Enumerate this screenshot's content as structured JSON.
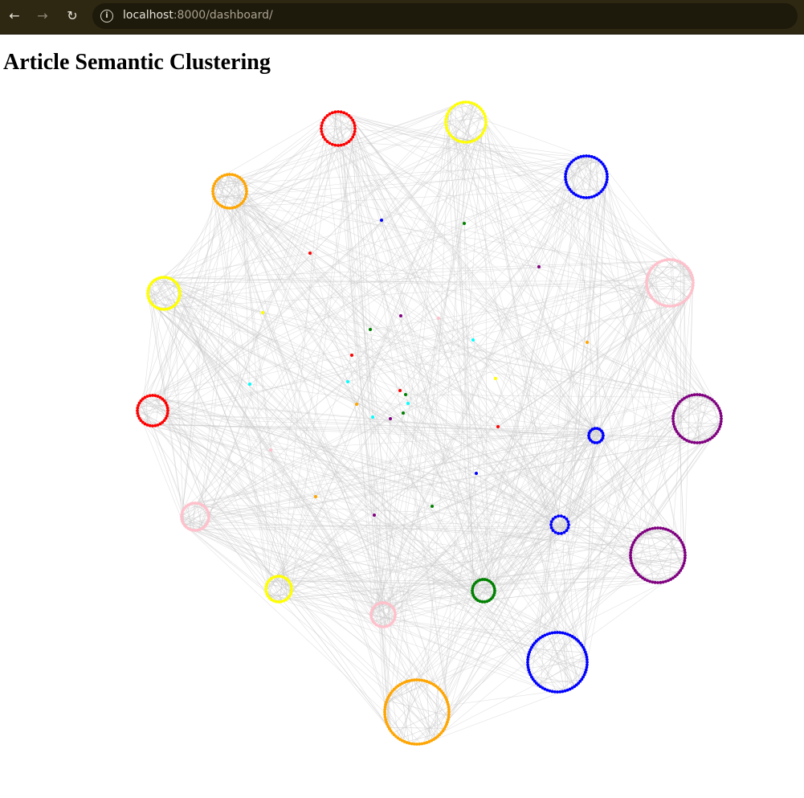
{
  "browser": {
    "back_icon": "arrow-left-icon",
    "forward_icon": "arrow-right-icon",
    "reload_icon": "reload-icon",
    "site_info_icon": "info-icon",
    "url_host": "localhost",
    "url_rest": ":8000/dashboard/"
  },
  "page": {
    "title": "Article Semantic Clustering"
  },
  "graph": {
    "edge_color": "#c8c8c8",
    "clusters": [
      {
        "color": "red",
        "nodes": 36
      },
      {
        "color": "yellow",
        "nodes": 44
      },
      {
        "color": "blue",
        "nodes": 48
      },
      {
        "color": "orange",
        "nodes": 40
      },
      {
        "color": "pink",
        "nodes": 56
      },
      {
        "color": "yellow",
        "nodes": 40
      },
      {
        "color": "purple",
        "nodes": 56
      },
      {
        "color": "red",
        "nodes": 36
      },
      {
        "color": "blue",
        "nodes": 18
      },
      {
        "color": "pink",
        "nodes": 36
      },
      {
        "color": "blue",
        "nodes": 18
      },
      {
        "color": "purple",
        "nodes": 64
      },
      {
        "color": "yellow",
        "nodes": 32
      },
      {
        "color": "green",
        "nodes": 30
      },
      {
        "color": "pink",
        "nodes": 32
      },
      {
        "color": "blue",
        "nodes": 72
      },
      {
        "color": "orange",
        "nodes": 80
      }
    ],
    "singletons": [
      "blue",
      "green",
      "red",
      "purple",
      "yellow",
      "purple",
      "pink",
      "green",
      "cyan",
      "orange",
      "red",
      "cyan",
      "yellow",
      "cyan",
      "red",
      "green",
      "orange",
      "cyan",
      "cyan",
      "green",
      "purple",
      "red",
      "pink",
      "blue",
      "orange",
      "purple",
      "green"
    ]
  }
}
